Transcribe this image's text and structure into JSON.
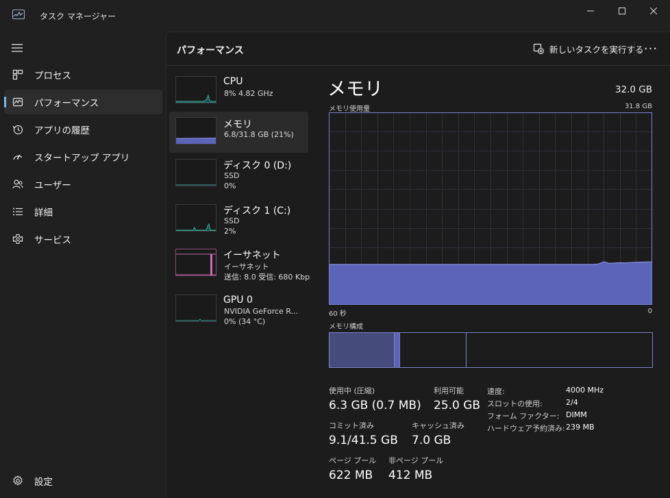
{
  "window": {
    "title": "タスク マネージャー",
    "controls": [
      "minimize-icon",
      "maximize-icon",
      "close-icon"
    ]
  },
  "sidebar": {
    "items": [
      {
        "label": "プロセス",
        "icon": "processes-icon",
        "active": false
      },
      {
        "label": "パフォーマンス",
        "icon": "performance-icon",
        "active": true
      },
      {
        "label": "アプリの履歴",
        "icon": "app-history-icon",
        "active": false
      },
      {
        "label": "スタートアップ アプリ",
        "icon": "startup-icon",
        "active": false
      },
      {
        "label": "ユーザー",
        "icon": "users-icon",
        "active": false
      },
      {
        "label": "詳細",
        "icon": "details-icon",
        "active": false
      },
      {
        "label": "サービス",
        "icon": "services-icon",
        "active": false
      }
    ],
    "settings_label": "設定"
  },
  "header": {
    "title": "パフォーマンス",
    "run_task_label": "新しいタスクを実行する",
    "more_label": "···"
  },
  "devices": [
    {
      "name": "CPU",
      "line1": "8%  4.82 GHz",
      "line2": "",
      "active": false,
      "color": "#3aa7a1",
      "kind": "cpu"
    },
    {
      "name": "メモリ",
      "line1": "6.8/31.8 GB (21%)",
      "line2": "",
      "active": true,
      "color": "#7a83d6",
      "kind": "memory"
    },
    {
      "name": "ディスク 0 (D:)",
      "line1": "SSD",
      "line2": "0%",
      "active": false,
      "color": "#3aa7a1",
      "kind": "disk"
    },
    {
      "name": "ディスク 1 (C:)",
      "line1": "SSD",
      "line2": "2%",
      "active": false,
      "color": "#3aa7a1",
      "kind": "disk"
    },
    {
      "name": "イーサネット",
      "line1": "イーサネット",
      "line2": "送信: 8.0  受信: 680 Kbps",
      "active": false,
      "color": "#c76fb0",
      "kind": "ethernet"
    },
    {
      "name": "GPU 0",
      "line1": "NVIDIA GeForce R...",
      "line2": "0%  (34 °C)",
      "active": false,
      "color": "#3aa7a1",
      "kind": "gpu"
    }
  ],
  "memory": {
    "title": "メモリ",
    "total": "32.0 GB",
    "usage_label": "メモリ使用量",
    "usage_max": "31.8 GB",
    "time_left": "60 秒",
    "time_right": "0",
    "composition_label": "メモリ構成",
    "accent_color": "#7a83d6",
    "fill_color": "#5b64b8",
    "composition": {
      "in_use_fraction": 0.2,
      "modified_fraction": 0.016,
      "standby_fraction": 0.206,
      "free_fraction": 0.578
    },
    "usage_history_percent": [
      21,
      21,
      21,
      21,
      21,
      21,
      21,
      21,
      21,
      21,
      21,
      21,
      21,
      21,
      21,
      21,
      21,
      21,
      21,
      21,
      21,
      21,
      21,
      21,
      21,
      21,
      21,
      21,
      21,
      21,
      21,
      21,
      21,
      21,
      21,
      21,
      21,
      21,
      21,
      21,
      21,
      21,
      21,
      21,
      21,
      21,
      21,
      21,
      21,
      21,
      21.2,
      22.4,
      21.6,
      21.7,
      21.9,
      21.8,
      22,
      22.1,
      22.2,
      22.3,
      22.3
    ],
    "stats": {
      "in_use_label": "使用中 (圧縮)",
      "in_use_value": "6.3 GB (0.7 MB)",
      "available_label": "利用可能",
      "available_value": "25.0 GB",
      "committed_label": "コミット済み",
      "committed_value": "9.1/41.5 GB",
      "cached_label": "キャッシュ済み",
      "cached_value": "7.0 GB",
      "paged_label": "ページ プール",
      "paged_value": "622 MB",
      "nonpaged_label": "非ページ プール",
      "nonpaged_value": "412 MB"
    },
    "details": [
      {
        "label": "速度:",
        "value": "4000 MHz"
      },
      {
        "label": "スロットの使用:",
        "value": "2/4"
      },
      {
        "label": "フォーム ファクター:",
        "value": "DIMM"
      },
      {
        "label": "ハードウェア予約済み:",
        "value": "239 MB"
      }
    ]
  }
}
